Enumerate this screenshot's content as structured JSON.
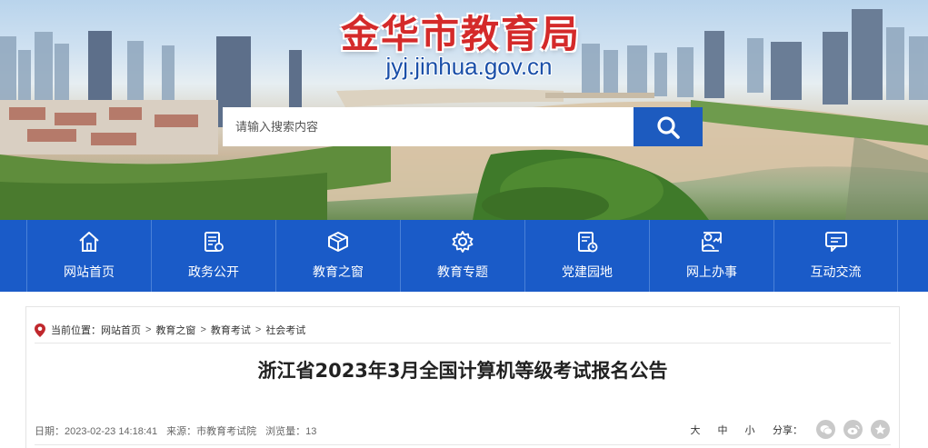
{
  "header": {
    "site_title": "金华市教育局",
    "site_domain": "jyj.jinhua.gov.cn"
  },
  "search": {
    "placeholder": "请输入搜索内容",
    "button_icon": "search-icon"
  },
  "nav": {
    "items": [
      {
        "label": "网站首页",
        "icon": "home-icon"
      },
      {
        "label": "政务公开",
        "icon": "document-icon"
      },
      {
        "label": "教育之窗",
        "icon": "cube-icon"
      },
      {
        "label": "教育专题",
        "icon": "gear-icon"
      },
      {
        "label": "党建园地",
        "icon": "calendar-icon"
      },
      {
        "label": "网上办事",
        "icon": "user-chart-icon"
      },
      {
        "label": "互动交流",
        "icon": "chat-icon"
      }
    ]
  },
  "breadcrumb": {
    "prefix": "当前位置：",
    "items": [
      "网站首页",
      "教育之窗",
      "教育考试",
      "社会考试"
    ],
    "separator": ">"
  },
  "article": {
    "title": "浙江省2023年3月全国计算机等级考试报名公告",
    "date_label": "日期：",
    "date": "2023-02-23 14:18:41",
    "source_label": "来源：",
    "source": "市教育考试院",
    "views_label": "浏览量：",
    "views": "13"
  },
  "toolbar": {
    "font_large": "大",
    "font_medium": "中",
    "font_small": "小",
    "share_label": "分享：",
    "share_icons": [
      "wechat-icon",
      "weibo-icon",
      "favorite-icon"
    ]
  },
  "colors": {
    "nav_bg": "#1a5bc8",
    "title_red": "#d42a2a",
    "domain_blue": "#1a4fa8",
    "search_btn": "#1d5bbf"
  }
}
